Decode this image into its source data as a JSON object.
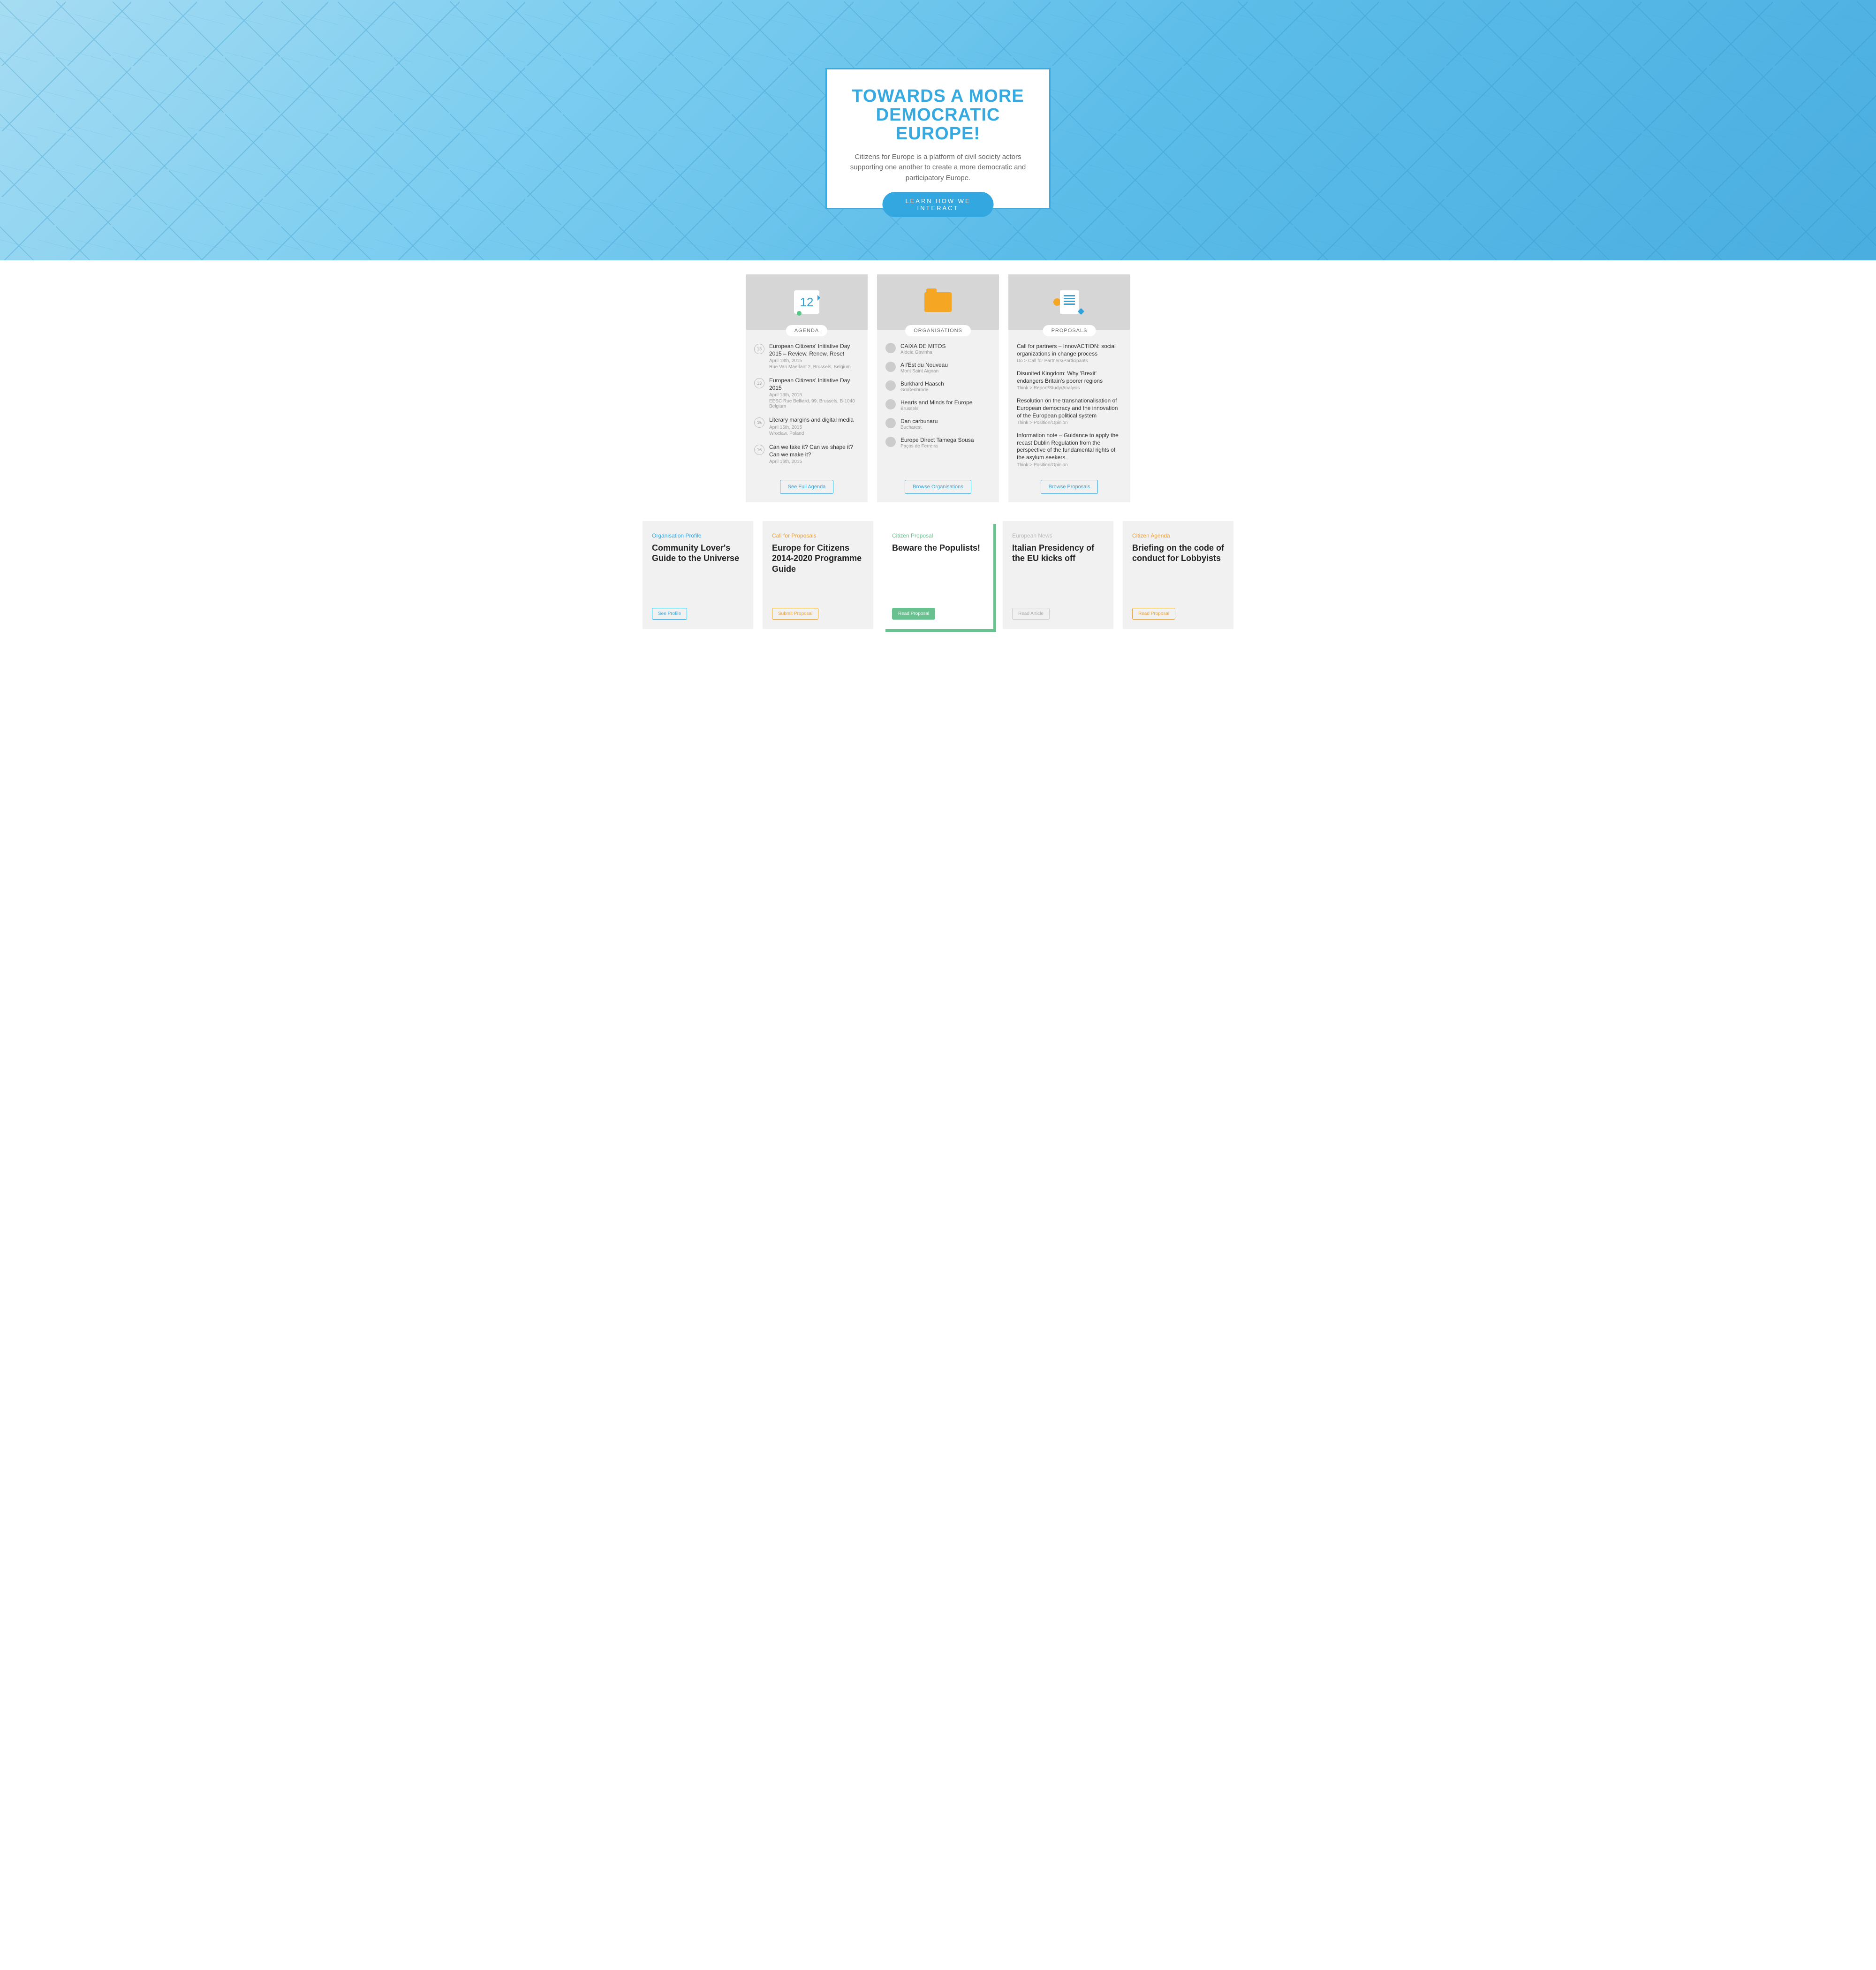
{
  "hero": {
    "title_line1": "TOWARDS A MORE",
    "title_line2": "DEMOCRATIC EUROPE!",
    "subtitle": "Citizens for Europe is a platform of civil society actors supporting one another to create a more democratic and participatory Europe.",
    "cta": "LEARN HOW WE INTERACT"
  },
  "columns": {
    "agenda": {
      "badge": "AGENDA",
      "icon_label": "12",
      "action": "See Full Agenda",
      "items": [
        {
          "day": "13",
          "title": "European Citizens' Initiative Day 2015 – Review, Renew, Reset",
          "date": "April 13th, 2015",
          "location": "Rue Van Maerlant 2, Brussels, Belgium"
        },
        {
          "day": "13",
          "title": "European Citizens' Initiative Day 2015",
          "date": "April 13th, 2015",
          "location": "EESC Rue Belliard, 99, Brussels, B-1040 Belgium"
        },
        {
          "day": "15",
          "title": "Literary margins and digital media",
          "date": "April 15th, 2015",
          "location": "Wrocław, Poland"
        },
        {
          "day": "16",
          "title": "Can we take it? Can we shape it? Can we make it?",
          "date": "April 16th, 2015",
          "location": ""
        }
      ]
    },
    "organisations": {
      "badge": "ORGANISATIONS",
      "action": "Browse Organisations",
      "items": [
        {
          "name": "CAIXA DE MITOS",
          "location": "Aldeia Gavinha"
        },
        {
          "name": "A l'Est du Nouveau",
          "location": "Mont Saint Aignan"
        },
        {
          "name": "Burkhard Haasch",
          "location": "Großenbrode"
        },
        {
          "name": "Hearts and Minds for Europe",
          "location": "Brussels"
        },
        {
          "name": "Dan carbunaru",
          "location": "Bucharest"
        },
        {
          "name": "Europe Direct Tamega Sousa",
          "location": "Paços de Ferreira"
        }
      ]
    },
    "proposals": {
      "badge": "PROPOSALS",
      "action": "Browse Proposals",
      "items": [
        {
          "title": "Call for partners – InnovACTION: social organizations in change process",
          "category": "Do > Call for Partners/Participants"
        },
        {
          "title": "Disunited Kingdom: Why 'Brexit' endangers Britain's poorer regions",
          "category": "Think > Report/Study/Analysis"
        },
        {
          "title": "Resolution on the transnationalisation of European democracy and the innovation of the European political system",
          "category": "Think > Position/Opinion"
        },
        {
          "title": "Information note – Guidance to apply the recast Dublin Regulation from the perspective of the fundamental rights of the asylum seekers.",
          "category": "Think > Position/Opinion"
        }
      ]
    }
  },
  "cards": [
    {
      "variant": "blue",
      "category": "Organisation Profile",
      "title": "Community Lover's Guide to the Universe",
      "button": "See Profile"
    },
    {
      "variant": "orange",
      "category": "Call for Proposals",
      "title": "Europe for Citizens 2014-2020 Programme Guide",
      "button": "Submit Proposal"
    },
    {
      "variant": "green",
      "category": "Citizen Proposal",
      "title": "Beware the Populists!",
      "button": "Read Proposal"
    },
    {
      "variant": "gray",
      "category": "European News",
      "title": "Italian Presidency of the EU kicks off",
      "button": "Read Article"
    },
    {
      "variant": "orange",
      "category": "Citizen Agenda",
      "title": "Briefing on the code of conduct for Lobbyists",
      "button": "Read Proposal"
    }
  ]
}
